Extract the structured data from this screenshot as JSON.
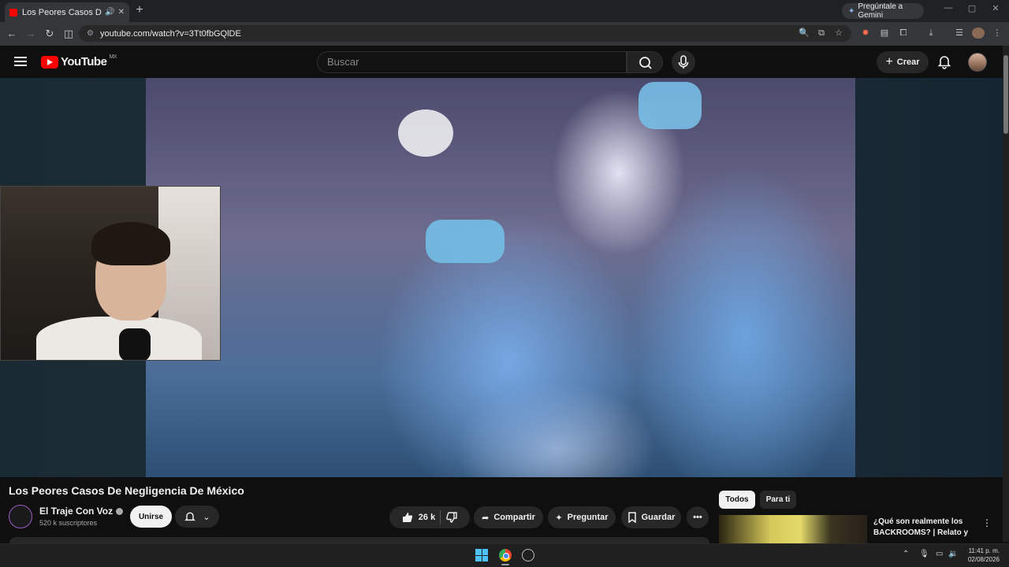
{
  "browser": {
    "tab_title": "Los Peores Casos De Neglig",
    "tab_sound_icon": "speaker-icon",
    "url": "youtube.com/watch?v=3Tt0fbGQlDE",
    "gemini_button": "Pregúntale a Gemini"
  },
  "youtube": {
    "logo_text": "YouTube",
    "region": "MX",
    "search_placeholder": "Buscar",
    "create_label": "Crear"
  },
  "video": {
    "title": "Los Peores Casos De Negligencia De México",
    "channel_name": "El Traje Con Voz",
    "subscribers": "520 k suscriptores",
    "join_label": "Unirse",
    "likes": "26 k",
    "share_label": "Compartir",
    "ask_label": "Preguntar",
    "save_label": "Guardar"
  },
  "sidebar": {
    "chips": [
      "Todos",
      "Para ti"
    ],
    "recommendation_title": "¿Qué son realmente los BACKROOMS? | Relato y ..."
  },
  "taskbar": {
    "time": "11:41 p. m.",
    "date": "02/08/2026"
  },
  "colors": {
    "accent_red": "#ff0000",
    "background": "#0f0f0f",
    "chip_active": "#f1f1f1"
  }
}
